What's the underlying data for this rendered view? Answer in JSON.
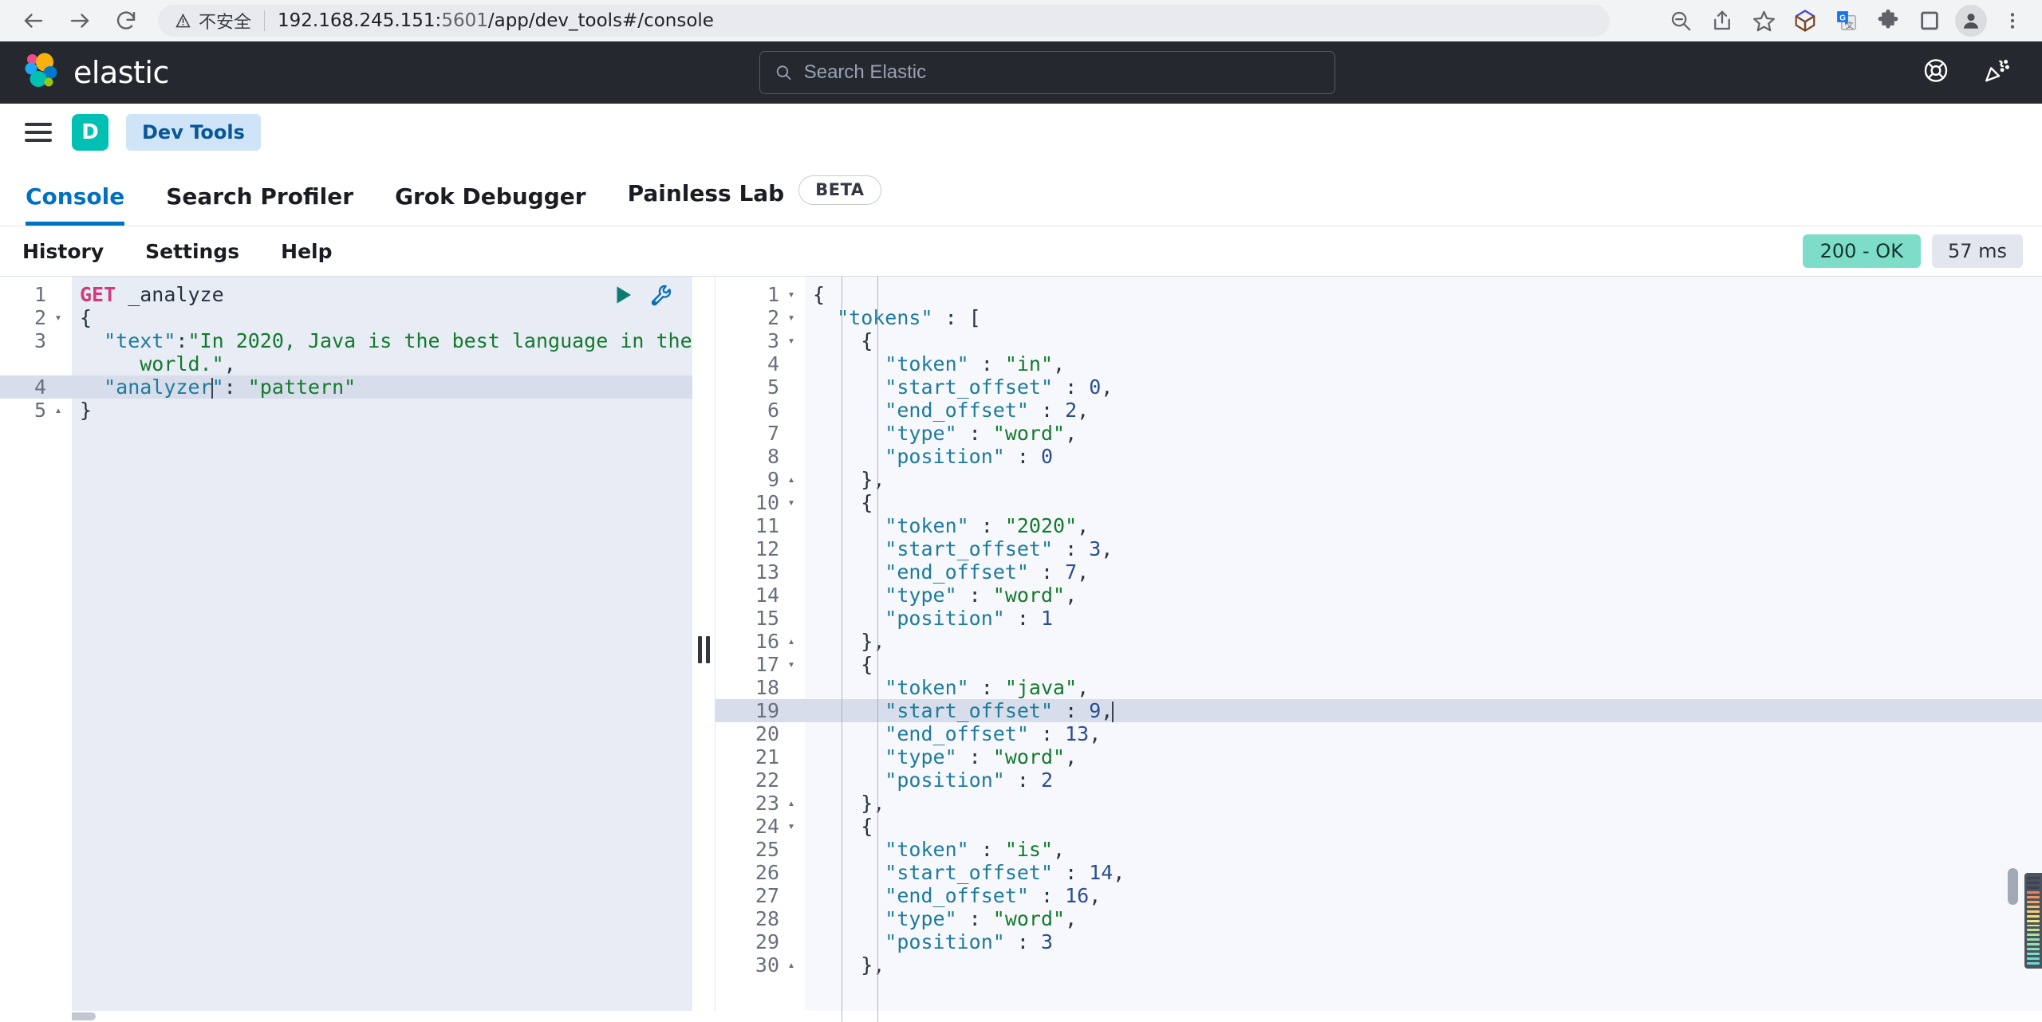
{
  "browser": {
    "back_icon": "back-arrow-icon",
    "forward_icon": "forward-arrow-icon",
    "reload_icon": "reload-icon",
    "security_label": "不安全",
    "url_prefix": "192.168.245.151:",
    "url_port": "5601",
    "url_path": "/app/dev_tools#/console",
    "url_full": "192.168.245.151:5601/app/dev_tools#/console",
    "toolbar_icons": [
      "zoom-out-icon",
      "share-icon",
      "bookmark-star-icon",
      "cube-extension-icon",
      "google-translate-icon",
      "puzzle-extensions-icon",
      "side-panel-icon",
      "profile-avatar-icon",
      "kebab-menu-icon"
    ]
  },
  "header": {
    "brand": "elastic",
    "search_placeholder": "Search Elastic",
    "search_value": "",
    "right_icons": [
      "help-lifebuoy-icon",
      "whats-new-party-icon"
    ]
  },
  "breadcrumb": {
    "menu_icon": "hamburger-menu-icon",
    "space_initial": "D",
    "crumb": "Dev Tools"
  },
  "tabs": [
    {
      "label": "Console",
      "active": true,
      "badge": null
    },
    {
      "label": "Search Profiler",
      "active": false,
      "badge": null
    },
    {
      "label": "Grok Debugger",
      "active": false,
      "badge": null
    },
    {
      "label": "Painless Lab",
      "active": false,
      "badge": "BETA"
    }
  ],
  "console_toolbar": {
    "links": [
      "History",
      "Settings",
      "Help"
    ],
    "status_code": "200 - OK",
    "status_time": "57 ms",
    "status_color": "#7dddc8"
  },
  "editor": {
    "run_icon": "play-triangle-icon",
    "wrench_icon": "wrench-icon",
    "active_line": 4,
    "lines": [
      {
        "n": "1",
        "fold": "",
        "parts": [
          {
            "c": "t-method",
            "t": "GET"
          },
          {
            "c": "t-url",
            "t": " _analyze"
          }
        ]
      },
      {
        "n": "2",
        "fold": "▾",
        "parts": [
          {
            "c": "t-punc",
            "t": "{"
          }
        ]
      },
      {
        "n": "3",
        "fold": "",
        "parts": [
          {
            "c": "t-key",
            "t": "  \"text\""
          },
          {
            "c": "t-punc",
            "t": ":"
          },
          {
            "c": "t-str",
            "t": "\"In 2020, Java is the best language in the"
          }
        ]
      },
      {
        "n": "",
        "fold": "",
        "parts": [
          {
            "c": "t-str",
            "t": "     world.\""
          },
          {
            "c": "t-punc",
            "t": ","
          }
        ]
      },
      {
        "n": "4",
        "fold": "",
        "hl": true,
        "parts": [
          {
            "c": "t-key",
            "t": "  \"analyzer"
          },
          {
            "c": "caret",
            "t": ""
          },
          {
            "c": "t-key",
            "t": "\""
          },
          {
            "c": "t-punc",
            "t": ": "
          },
          {
            "c": "t-str",
            "t": "\"pattern\""
          }
        ]
      },
      {
        "n": "5",
        "fold": "▴",
        "parts": [
          {
            "c": "t-punc",
            "t": "}"
          }
        ]
      }
    ]
  },
  "output": {
    "active_line": 19,
    "lines": [
      {
        "n": "1",
        "fold": "▾",
        "parts": [
          {
            "c": "t-punc",
            "t": "{"
          }
        ]
      },
      {
        "n": "2",
        "fold": "▾",
        "parts": [
          {
            "c": "t-key",
            "t": "  \"tokens\""
          },
          {
            "c": "t-punc",
            "t": " : ["
          }
        ]
      },
      {
        "n": "3",
        "fold": "▾",
        "parts": [
          {
            "c": "t-punc",
            "t": "    {"
          }
        ]
      },
      {
        "n": "4",
        "fold": "",
        "parts": [
          {
            "c": "t-key",
            "t": "      \"token\""
          },
          {
            "c": "t-punc",
            "t": " : "
          },
          {
            "c": "t-str",
            "t": "\"in\""
          },
          {
            "c": "t-punc",
            "t": ","
          }
        ]
      },
      {
        "n": "5",
        "fold": "",
        "parts": [
          {
            "c": "t-key",
            "t": "      \"start_offset\""
          },
          {
            "c": "t-punc",
            "t": " : "
          },
          {
            "c": "t-num",
            "t": "0"
          },
          {
            "c": "t-punc",
            "t": ","
          }
        ]
      },
      {
        "n": "6",
        "fold": "",
        "parts": [
          {
            "c": "t-key",
            "t": "      \"end_offset\""
          },
          {
            "c": "t-punc",
            "t": " : "
          },
          {
            "c": "t-num",
            "t": "2"
          },
          {
            "c": "t-punc",
            "t": ","
          }
        ]
      },
      {
        "n": "7",
        "fold": "",
        "parts": [
          {
            "c": "t-key",
            "t": "      \"type\""
          },
          {
            "c": "t-punc",
            "t": " : "
          },
          {
            "c": "t-str",
            "t": "\"word\""
          },
          {
            "c": "t-punc",
            "t": ","
          }
        ]
      },
      {
        "n": "8",
        "fold": "",
        "parts": [
          {
            "c": "t-key",
            "t": "      \"position\""
          },
          {
            "c": "t-punc",
            "t": " : "
          },
          {
            "c": "t-num",
            "t": "0"
          }
        ]
      },
      {
        "n": "9",
        "fold": "▴",
        "parts": [
          {
            "c": "t-punc",
            "t": "    },"
          }
        ]
      },
      {
        "n": "10",
        "fold": "▾",
        "parts": [
          {
            "c": "t-punc",
            "t": "    {"
          }
        ]
      },
      {
        "n": "11",
        "fold": "",
        "parts": [
          {
            "c": "t-key",
            "t": "      \"token\""
          },
          {
            "c": "t-punc",
            "t": " : "
          },
          {
            "c": "t-str",
            "t": "\"2020\""
          },
          {
            "c": "t-punc",
            "t": ","
          }
        ]
      },
      {
        "n": "12",
        "fold": "",
        "parts": [
          {
            "c": "t-key",
            "t": "      \"start_offset\""
          },
          {
            "c": "t-punc",
            "t": " : "
          },
          {
            "c": "t-num",
            "t": "3"
          },
          {
            "c": "t-punc",
            "t": ","
          }
        ]
      },
      {
        "n": "13",
        "fold": "",
        "parts": [
          {
            "c": "t-key",
            "t": "      \"end_offset\""
          },
          {
            "c": "t-punc",
            "t": " : "
          },
          {
            "c": "t-num",
            "t": "7"
          },
          {
            "c": "t-punc",
            "t": ","
          }
        ]
      },
      {
        "n": "14",
        "fold": "",
        "parts": [
          {
            "c": "t-key",
            "t": "      \"type\""
          },
          {
            "c": "t-punc",
            "t": " : "
          },
          {
            "c": "t-str",
            "t": "\"word\""
          },
          {
            "c": "t-punc",
            "t": ","
          }
        ]
      },
      {
        "n": "15",
        "fold": "",
        "parts": [
          {
            "c": "t-key",
            "t": "      \"position\""
          },
          {
            "c": "t-punc",
            "t": " : "
          },
          {
            "c": "t-num",
            "t": "1"
          }
        ]
      },
      {
        "n": "16",
        "fold": "▴",
        "parts": [
          {
            "c": "t-punc",
            "t": "    },"
          }
        ]
      },
      {
        "n": "17",
        "fold": "▾",
        "parts": [
          {
            "c": "t-punc",
            "t": "    {"
          }
        ]
      },
      {
        "n": "18",
        "fold": "",
        "parts": [
          {
            "c": "t-key",
            "t": "      \"token\""
          },
          {
            "c": "t-punc",
            "t": " : "
          },
          {
            "c": "t-str",
            "t": "\"java\""
          },
          {
            "c": "t-punc",
            "t": ","
          }
        ]
      },
      {
        "n": "19",
        "fold": "",
        "hl": true,
        "parts": [
          {
            "c": "t-key",
            "t": "      \"start_offset\""
          },
          {
            "c": "t-punc",
            "t": " : "
          },
          {
            "c": "t-num",
            "t": "9"
          },
          {
            "c": "t-punc",
            "t": ","
          },
          {
            "c": "caret",
            "t": ""
          }
        ]
      },
      {
        "n": "20",
        "fold": "",
        "parts": [
          {
            "c": "t-key",
            "t": "      \"end_offset\""
          },
          {
            "c": "t-punc",
            "t": " : "
          },
          {
            "c": "t-num",
            "t": "13"
          },
          {
            "c": "t-punc",
            "t": ","
          }
        ]
      },
      {
        "n": "21",
        "fold": "",
        "parts": [
          {
            "c": "t-key",
            "t": "      \"type\""
          },
          {
            "c": "t-punc",
            "t": " : "
          },
          {
            "c": "t-str",
            "t": "\"word\""
          },
          {
            "c": "t-punc",
            "t": ","
          }
        ]
      },
      {
        "n": "22",
        "fold": "",
        "parts": [
          {
            "c": "t-key",
            "t": "      \"position\""
          },
          {
            "c": "t-punc",
            "t": " : "
          },
          {
            "c": "t-num",
            "t": "2"
          }
        ]
      },
      {
        "n": "23",
        "fold": "▴",
        "parts": [
          {
            "c": "t-punc",
            "t": "    },"
          }
        ]
      },
      {
        "n": "24",
        "fold": "▾",
        "parts": [
          {
            "c": "t-punc",
            "t": "    {"
          }
        ]
      },
      {
        "n": "25",
        "fold": "",
        "parts": [
          {
            "c": "t-key",
            "t": "      \"token\""
          },
          {
            "c": "t-punc",
            "t": " : "
          },
          {
            "c": "t-str",
            "t": "\"is\""
          },
          {
            "c": "t-punc",
            "t": ","
          }
        ]
      },
      {
        "n": "26",
        "fold": "",
        "parts": [
          {
            "c": "t-key",
            "t": "      \"start_offset\""
          },
          {
            "c": "t-punc",
            "t": " : "
          },
          {
            "c": "t-num",
            "t": "14"
          },
          {
            "c": "t-punc",
            "t": ","
          }
        ]
      },
      {
        "n": "27",
        "fold": "",
        "parts": [
          {
            "c": "t-key",
            "t": "      \"end_offset\""
          },
          {
            "c": "t-punc",
            "t": " : "
          },
          {
            "c": "t-num",
            "t": "16"
          },
          {
            "c": "t-punc",
            "t": ","
          }
        ]
      },
      {
        "n": "28",
        "fold": "",
        "parts": [
          {
            "c": "t-key",
            "t": "      \"type\""
          },
          {
            "c": "t-punc",
            "t": " : "
          },
          {
            "c": "t-str",
            "t": "\"word\""
          },
          {
            "c": "t-punc",
            "t": ","
          }
        ]
      },
      {
        "n": "29",
        "fold": "",
        "parts": [
          {
            "c": "t-key",
            "t": "      \"position\""
          },
          {
            "c": "t-punc",
            "t": " : "
          },
          {
            "c": "t-num",
            "t": "3"
          }
        ]
      },
      {
        "n": "30",
        "fold": "▴",
        "parts": [
          {
            "c": "t-punc",
            "t": "    },"
          }
        ]
      }
    ]
  },
  "minimap_colors": [
    "#3b4250",
    "#3b4250",
    "#3b4250",
    "#ef7d5a",
    "#f2935b",
    "#f4a85f",
    "#f6bd62",
    "#f8cf66",
    "#f9df6a",
    "#e8e879",
    "#d3e884",
    "#bde68d",
    "#a8e498",
    "#92e2a3",
    "#95e3b5",
    "#86e0bd",
    "#79dec6",
    "#6ddcd0",
    "#62dad9"
  ]
}
